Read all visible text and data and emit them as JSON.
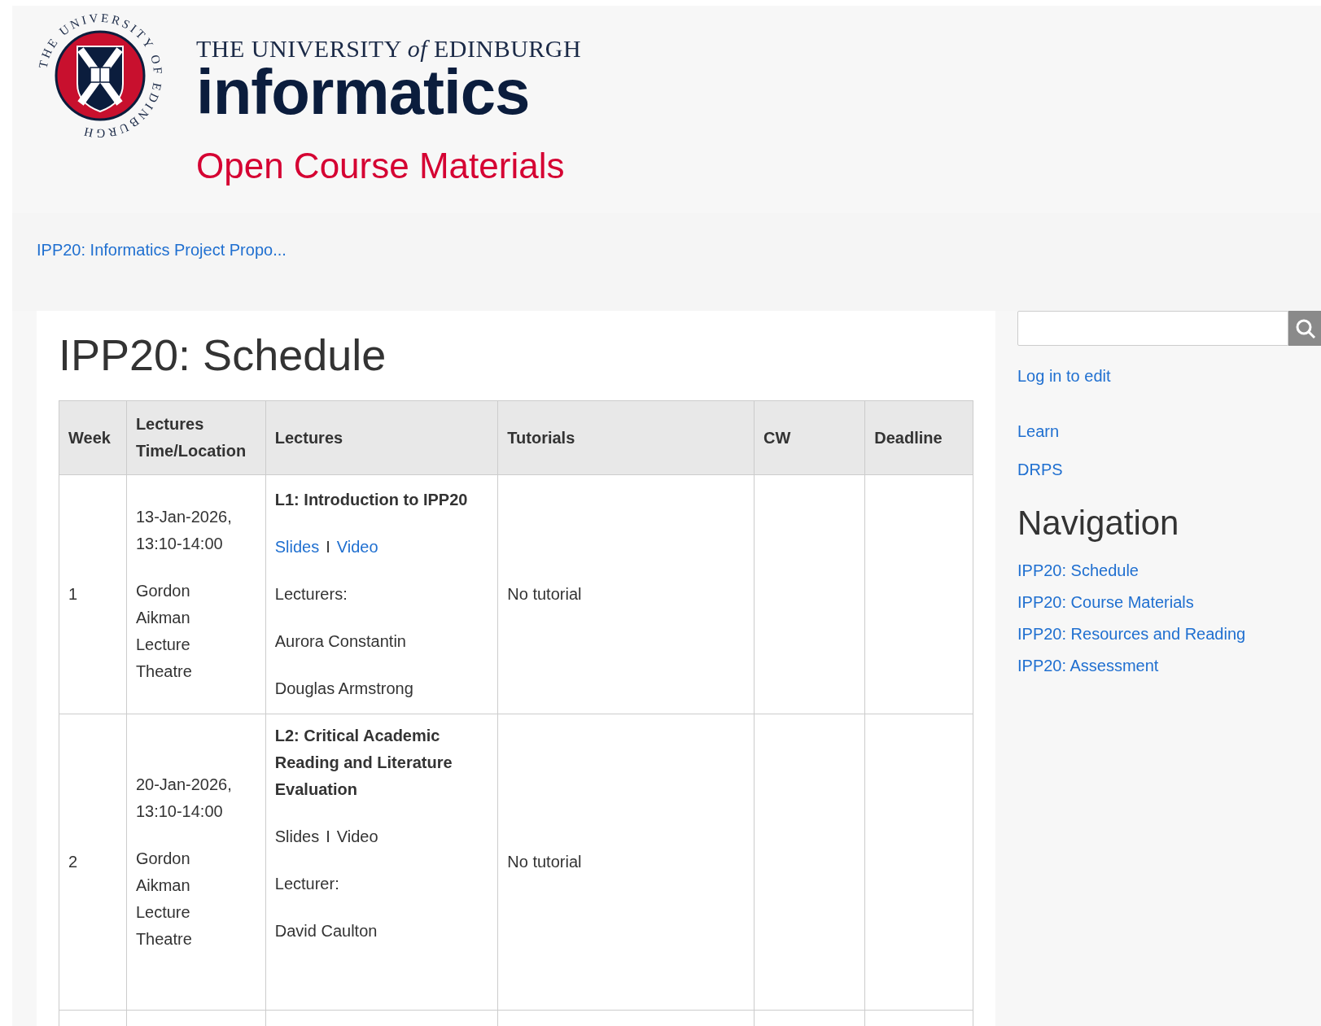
{
  "header": {
    "seal_text": "THE UNIVERSITY OF EDINBURGH",
    "university": "THE UNIVERSITY *of* EDINBURGH",
    "department": "informatics",
    "site_name": "Open Course Materials"
  },
  "breadcrumb": "IPP20: Informatics Project Propo...",
  "page": {
    "title": "IPP20: Schedule",
    "table": {
      "columns": [
        "Week",
        "Lectures Time/Location",
        "Lectures",
        "Tutorials",
        "CW",
        "Deadline"
      ],
      "rows": [
        {
          "week": "1",
          "date": "13-Jan-2026,",
          "time": "13:10-14:00",
          "location": [
            "Gordon",
            "Aikman",
            "Lecture",
            "Theatre"
          ],
          "lecture": [
            {
              "kind": "title",
              "text": "L1: Introduction to IPP20"
            },
            {
              "kind": "links",
              "parts": [
                {
                  "text": "Slides",
                  "link": true
                },
                {
                  "text": "I",
                  "link": false
                },
                {
                  "text": "Video",
                  "link": true
                }
              ]
            },
            {
              "kind": "text",
              "text": "Lecturers:"
            },
            {
              "kind": "text",
              "text": "Aurora Constantin"
            },
            {
              "kind": "text",
              "text": "Douglas Armstrong"
            }
          ],
          "tutorial": "No tutorial"
        },
        {
          "week": "2",
          "date": "20-Jan-2026,",
          "time": "13:10-14:00",
          "location": [
            "Gordon",
            "Aikman",
            "Lecture",
            "Theatre"
          ],
          "lecture": [
            {
              "kind": "title",
              "text": "L2: Critical Academic Reading and Literature Evaluation"
            },
            {
              "kind": "links",
              "parts": [
                {
                  "text": "Slides",
                  "link": false
                },
                {
                  "text": "I",
                  "link": false
                },
                {
                  "text": "Video",
                  "link": false
                }
              ]
            },
            {
              "kind": "text",
              "text": "Lecturer:"
            },
            {
              "kind": "text",
              "text": "David Caulton"
            }
          ],
          "tutorial": "No tutorial"
        }
      ]
    }
  },
  "sidebar": {
    "links": [
      "Log in to edit"
    ],
    "external_links": [
      "Learn",
      "DRPS"
    ],
    "navigation_title": "Navigation",
    "navigation": [
      "IPP20: Schedule",
      "IPP20: Course Materials",
      "IPP20: Resources and Reading",
      "IPP20: Assessment"
    ]
  }
}
